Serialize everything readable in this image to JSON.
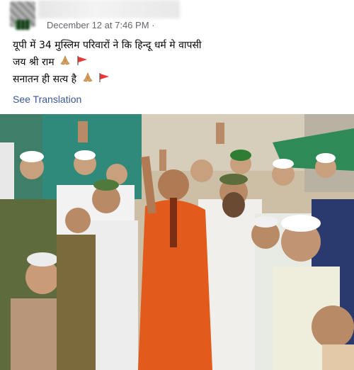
{
  "post": {
    "timestamp": "December 12 at 7:46 PM",
    "separator": "·",
    "lines": [
      "यूपी में 34 मुस्लिम परिवारों ने कि हिन्दू धर्म मे वापसी",
      "जय श्री राम",
      "सनातन ही सत्य है"
    ],
    "emojis": [
      "folded-hands-icon",
      "red-flag-icon"
    ],
    "see_translation": "See Translation"
  },
  "photo": {
    "description_icon": "group-photo"
  }
}
